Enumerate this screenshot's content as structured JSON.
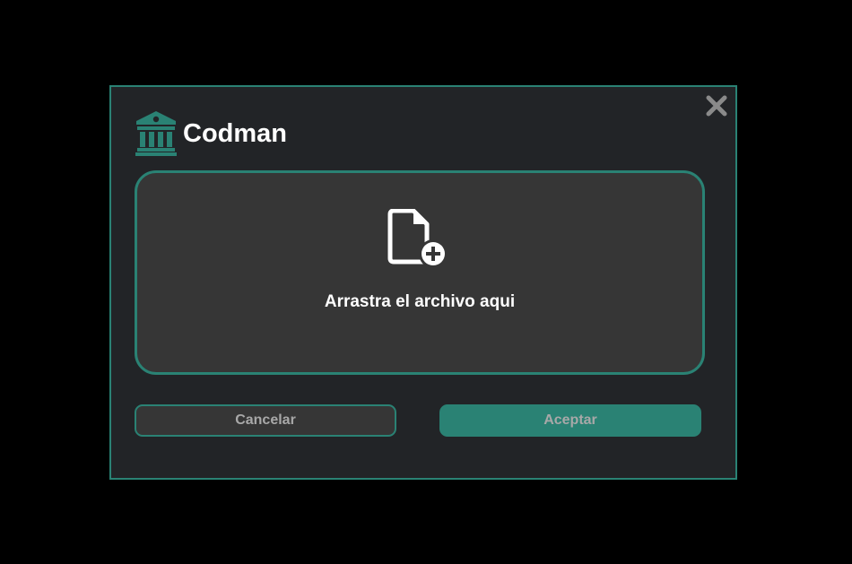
{
  "dialog": {
    "title": "Codman",
    "logo_icon": "bank-building-icon",
    "close_icon": "close-icon"
  },
  "dropzone": {
    "icon": "file-add-icon",
    "label": "Arrastra el archivo aqui"
  },
  "buttons": {
    "cancel_label": "Cancelar",
    "accept_label": "Aceptar"
  },
  "colors": {
    "accent": "#2a8274",
    "dialog_background": "#222427",
    "dropzone_background": "#363636",
    "page_background": "#000000",
    "button_text": "#a8a8a8",
    "close_icon": "#8a8a8a"
  }
}
